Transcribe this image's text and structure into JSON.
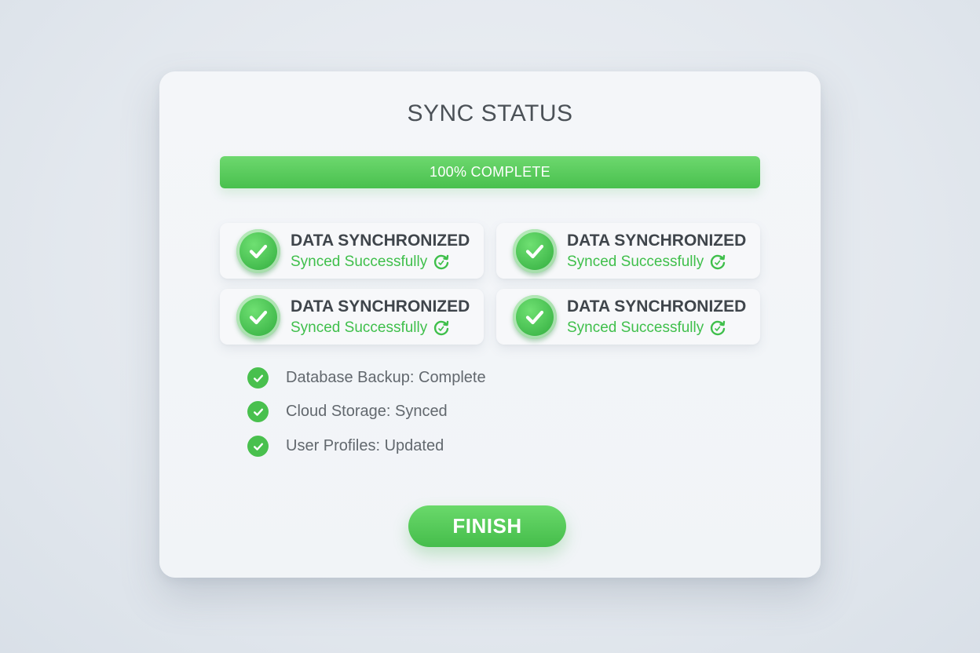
{
  "dialog": {
    "title": "SYNC STATUS",
    "progress": {
      "percent": 100,
      "label": "100% COMPLETE",
      "color": "#4cc252"
    },
    "tiles": [
      {
        "title": "DATA SYNCHRONIZED",
        "subtitle": "Synced Successfully",
        "icon": "check-circle-icon",
        "sub_icon": "sync-icon"
      },
      {
        "title": "DATA SYNCHRONIZED",
        "subtitle": "Synced Successfully",
        "icon": "check-circle-icon",
        "sub_icon": "sync-icon"
      },
      {
        "title": "DATA SYNCHRONIZED",
        "subtitle": "Synced Successfully",
        "icon": "check-circle-icon",
        "sub_icon": "sync-icon"
      },
      {
        "title": "DATA SYNCHRONIZED",
        "subtitle": "Synced Successfully",
        "icon": "check-circle-icon",
        "sub_icon": "sync-icon"
      }
    ],
    "status_items": [
      {
        "text": "Database Backup: Complete",
        "icon": "check-icon"
      },
      {
        "text": "Cloud Storage: Synced",
        "icon": "check-icon"
      },
      {
        "text": "User Profiles: Updated",
        "icon": "check-icon"
      }
    ],
    "finish_label": "FINISH"
  },
  "colors": {
    "accent": "#49c04e",
    "title_text": "#4b5157",
    "tile_title": "#3f454b",
    "tile_subtitle": "#3fbf4b",
    "status_text": "#62686e"
  }
}
